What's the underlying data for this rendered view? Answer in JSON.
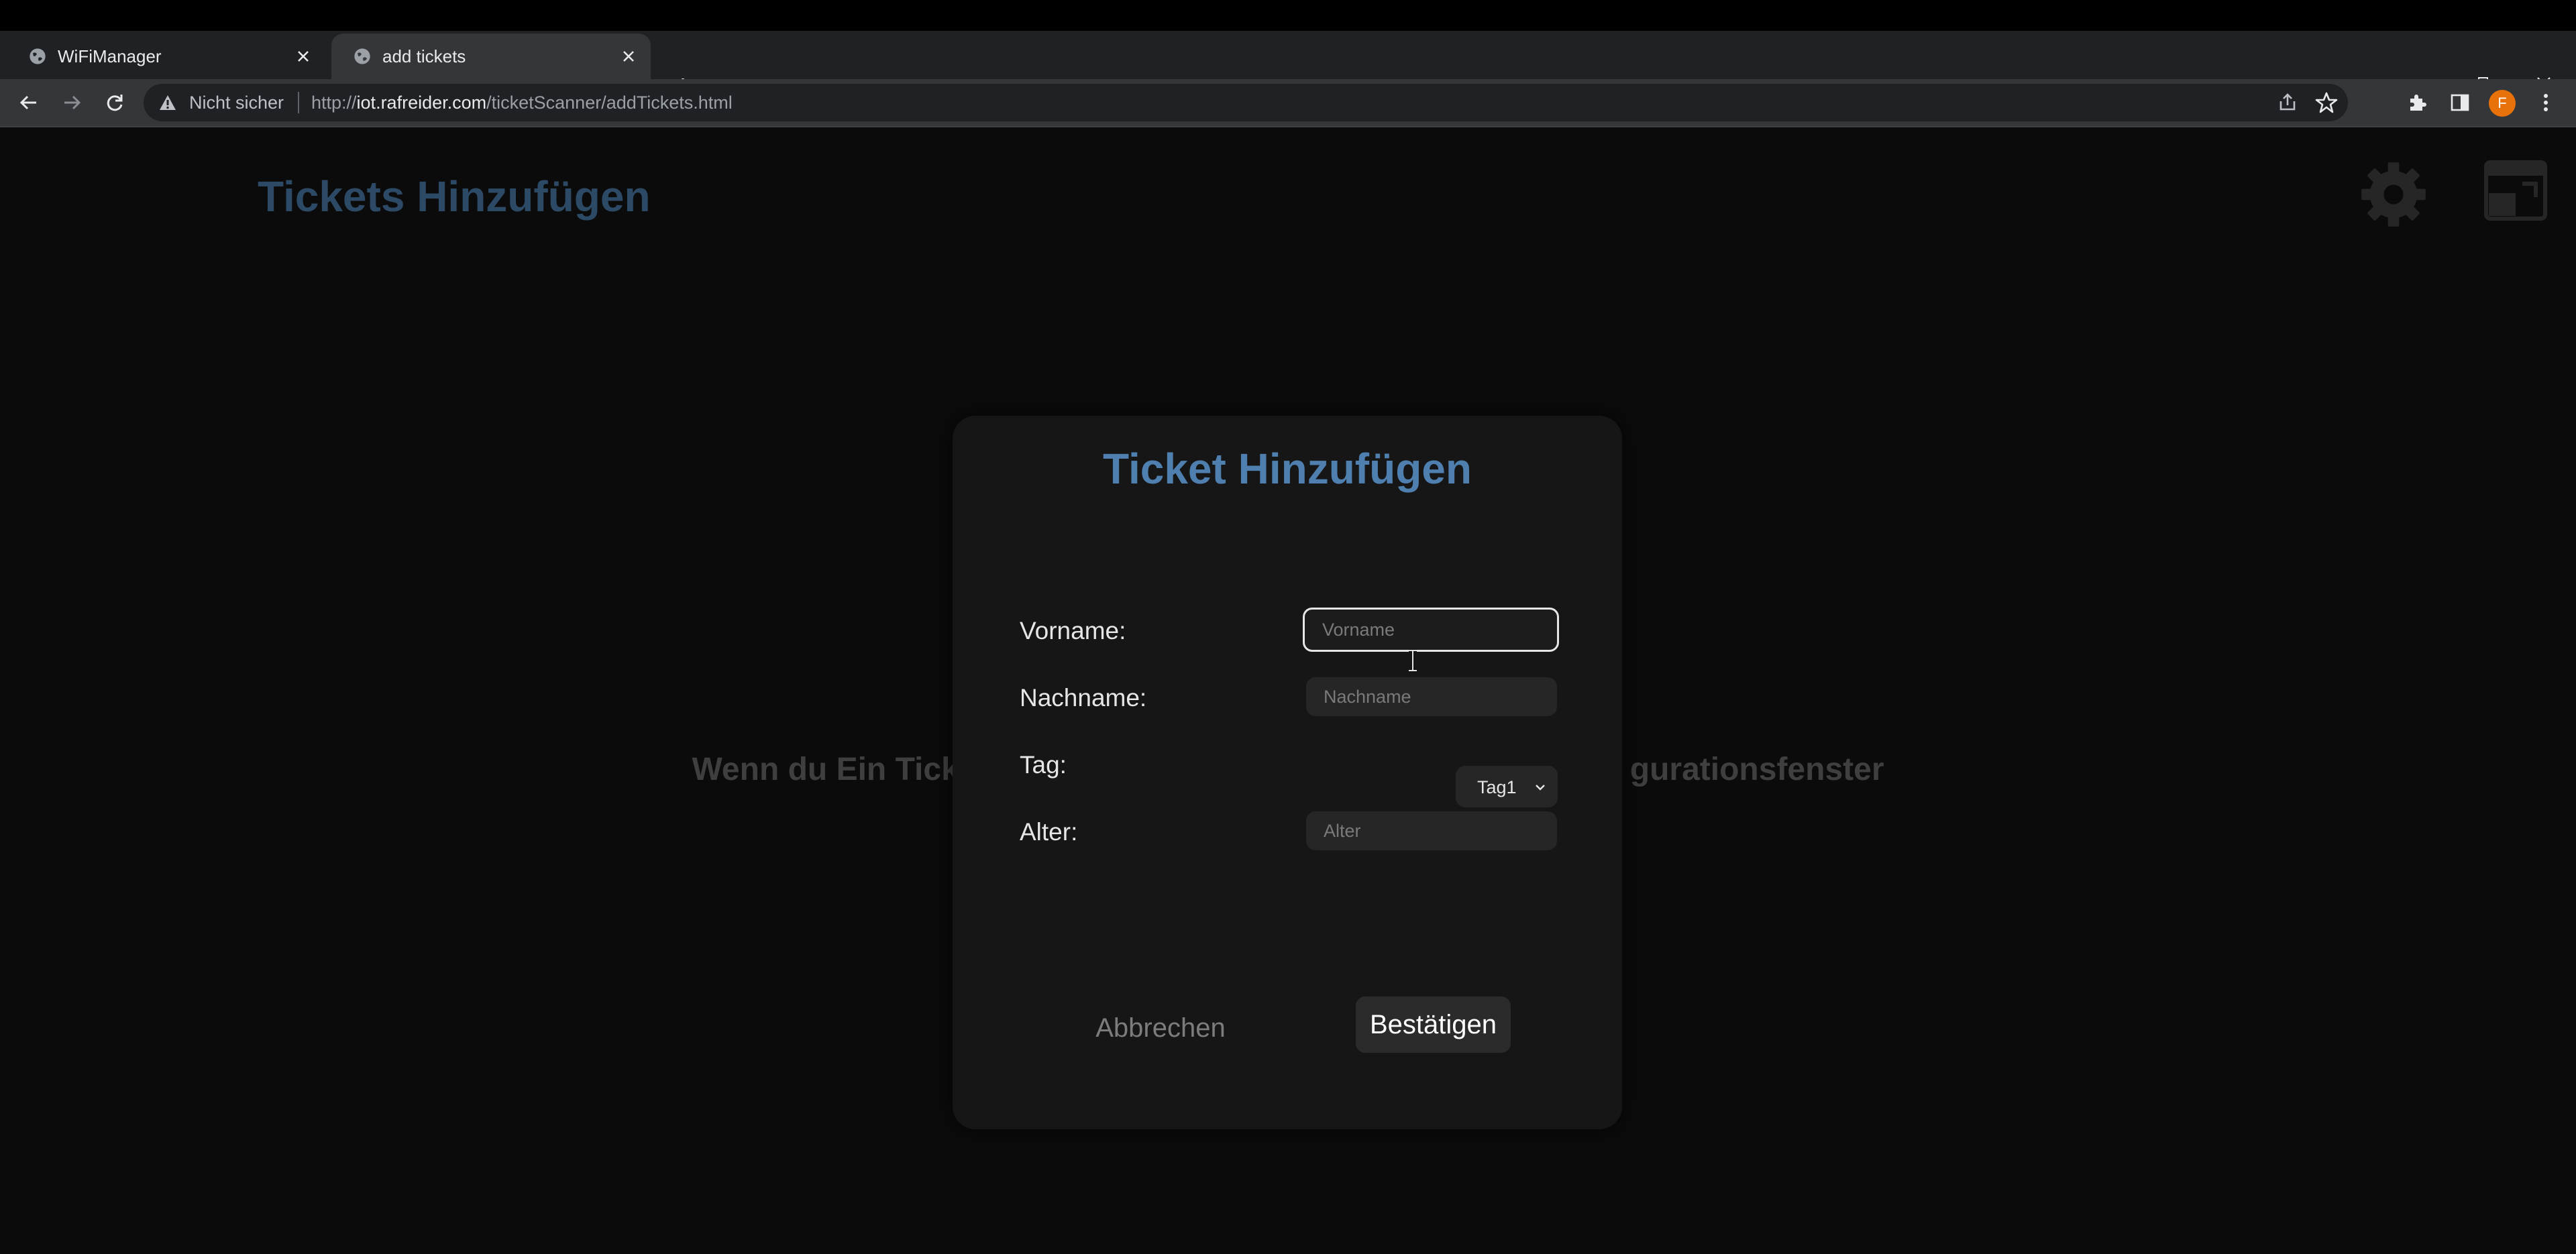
{
  "browser": {
    "tabs": [
      {
        "title": "WiFiManager",
        "active": false
      },
      {
        "title": "add tickets",
        "active": true
      }
    ],
    "address_bar": {
      "security_label": "Nicht sicher",
      "url_prefix": "http://",
      "url_host": "iot.rafreider.com",
      "url_path": "/ticketScanner/addTickets.html"
    },
    "profile_initial": "F"
  },
  "page": {
    "title": "Tickets Hinzufügen",
    "background_message": "Wenn du Ein Tick",
    "background_message_tail": "gurationsfenster"
  },
  "dialog": {
    "title": "Ticket Hinzufügen",
    "fields": {
      "vorname": {
        "label": "Vorname:",
        "placeholder": "Vorname",
        "value": ""
      },
      "nachname": {
        "label": "Nachname:",
        "placeholder": "Nachname",
        "value": ""
      },
      "tag": {
        "label": "Tag:",
        "selected": "Tag1"
      },
      "alter": {
        "label": "Alter:",
        "placeholder": "Alter",
        "value": ""
      }
    },
    "buttons": {
      "cancel": "Abbrechen",
      "confirm": "Bestätigen"
    }
  },
  "colors": {
    "page_title": "#2c4a66",
    "dialog_title": "#4e7fae",
    "avatar": "#e8710a"
  }
}
